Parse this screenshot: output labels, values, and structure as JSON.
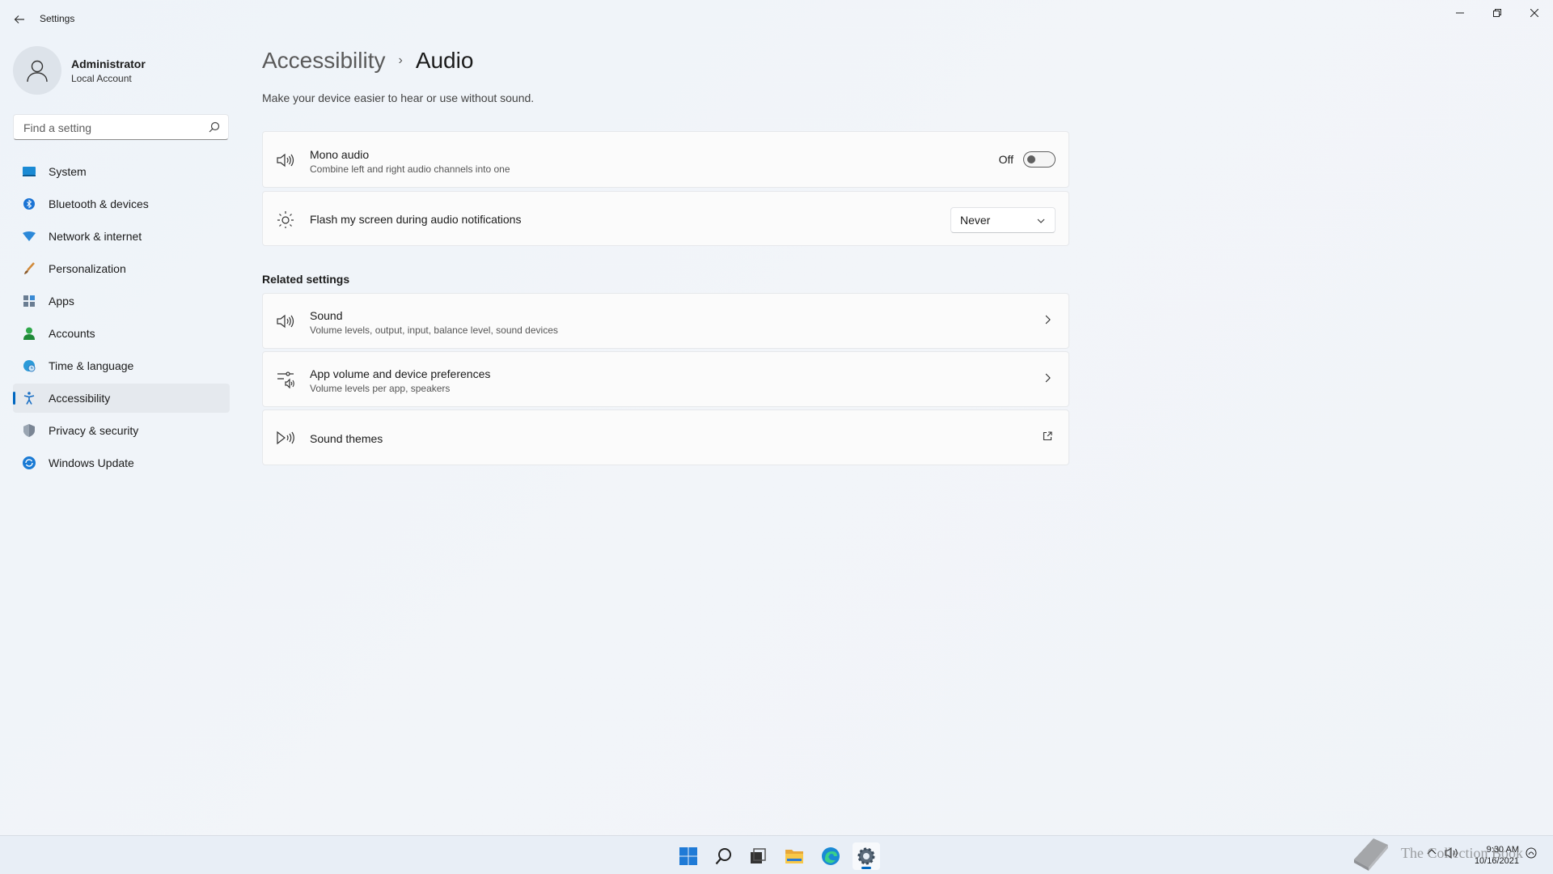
{
  "window": {
    "title": "Settings",
    "controls": [
      "minimize-icon",
      "restore-icon",
      "close-icon"
    ]
  },
  "profile": {
    "name": "Administrator",
    "account_type": "Local Account"
  },
  "search": {
    "placeholder": "Find a setting",
    "value": ""
  },
  "sidebar": {
    "items": [
      {
        "label": "System",
        "icon": "system-icon"
      },
      {
        "label": "Bluetooth & devices",
        "icon": "bluetooth-icon"
      },
      {
        "label": "Network & internet",
        "icon": "network-icon"
      },
      {
        "label": "Personalization",
        "icon": "personalization-icon"
      },
      {
        "label": "Apps",
        "icon": "apps-icon"
      },
      {
        "label": "Accounts",
        "icon": "accounts-icon"
      },
      {
        "label": "Time & language",
        "icon": "time-language-icon"
      },
      {
        "label": "Accessibility",
        "icon": "accessibility-icon",
        "active": true
      },
      {
        "label": "Privacy & security",
        "icon": "privacy-icon"
      },
      {
        "label": "Windows Update",
        "icon": "windows-update-icon"
      }
    ]
  },
  "breadcrumb": {
    "parent": "Accessibility",
    "separator": "›",
    "current": "Audio"
  },
  "page": {
    "description": "Make your device easier to hear or use without sound."
  },
  "settings": {
    "mono_audio": {
      "title": "Mono audio",
      "subtitle": "Combine left and right audio channels into one",
      "state_label": "Off",
      "enabled": false
    },
    "flash_screen": {
      "title": "Flash my screen during audio notifications",
      "selected": "Never"
    }
  },
  "related": {
    "heading": "Related settings",
    "items": [
      {
        "title": "Sound",
        "subtitle": "Volume levels, output, input, balance level, sound devices",
        "icon": "speaker-icon",
        "action": "chevron-right-icon"
      },
      {
        "title": "App volume and device preferences",
        "subtitle": "Volume levels per app, speakers",
        "icon": "mixer-icon",
        "action": "chevron-right-icon"
      },
      {
        "title": "Sound themes",
        "subtitle": "",
        "icon": "sound-themes-icon",
        "action": "external-link-icon"
      }
    ]
  },
  "taskbar": {
    "apps": [
      "start-icon",
      "search-icon",
      "task-view-icon",
      "file-explorer-icon",
      "edge-icon",
      "settings-icon"
    ],
    "clock_time": "9:30 AM",
    "clock_date": "10/16/2021"
  },
  "watermark": {
    "text": "The Collection Book"
  },
  "colors": {
    "accent": "#0067c0",
    "background": "#f0f4f9",
    "card": "#fbfbfb"
  }
}
